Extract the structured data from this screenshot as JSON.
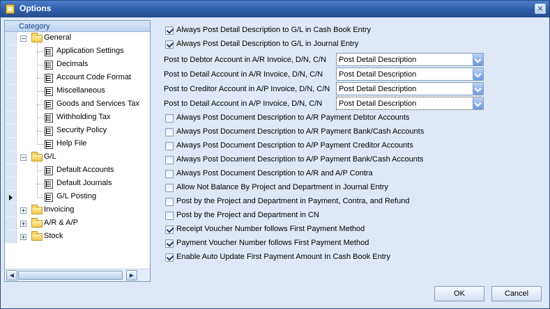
{
  "window": {
    "title": "Options",
    "title_icon": "app-icon",
    "close_icon": "close-icon"
  },
  "tree": {
    "header": "Category",
    "nodes": [
      {
        "label": "General",
        "level": 0,
        "type": "folder",
        "expanded": true
      },
      {
        "label": "Application Settings",
        "level": 1,
        "type": "leaf"
      },
      {
        "label": "Decimals",
        "level": 1,
        "type": "leaf"
      },
      {
        "label": "Account Code Format",
        "level": 1,
        "type": "leaf"
      },
      {
        "label": "Miscellaneous",
        "level": 1,
        "type": "leaf"
      },
      {
        "label": "Goods and Services Tax",
        "level": 1,
        "type": "leaf"
      },
      {
        "label": "Withholding Tax",
        "level": 1,
        "type": "leaf"
      },
      {
        "label": "Security Policy",
        "level": 1,
        "type": "leaf"
      },
      {
        "label": "Help File",
        "level": 1,
        "type": "leaf"
      },
      {
        "label": "G/L",
        "level": 0,
        "type": "folder",
        "expanded": true
      },
      {
        "label": "Default Accounts",
        "level": 1,
        "type": "leaf"
      },
      {
        "label": "Default Journals",
        "level": 1,
        "type": "leaf"
      },
      {
        "label": "G/L Posting",
        "level": 1,
        "type": "leaf",
        "current": true
      },
      {
        "label": "Invoicing",
        "level": 0,
        "type": "folder",
        "expanded": false
      },
      {
        "label": "A/R & A/P",
        "level": 0,
        "type": "folder",
        "expanded": false
      },
      {
        "label": "Stock",
        "level": 0,
        "type": "folder",
        "expanded": false
      }
    ]
  },
  "options": {
    "top_checks": [
      {
        "label": "Always Post Detail Description to G/L in Cash Book Entry",
        "checked": true
      },
      {
        "label": "Always Post Detail Description to G/L in Journal Entry",
        "checked": true
      }
    ],
    "combos": [
      {
        "label": "Post to Debtor Account in A/R Invoice, D/N, C/N",
        "value": "Post Detail Description",
        "focused": false
      },
      {
        "label": "Post to Detail Account in A/R Invoice, D/N, C/N",
        "value": "Post Detail Description",
        "focused": false
      },
      {
        "label": "Post to Creditor Account in A/P Invoice, D/N, C/N",
        "value": "Post Detail Description",
        "focused": false
      },
      {
        "label": "Post to Detail Account in A/P Invoice, D/N, C/N",
        "value": "Post Detail Description",
        "focused": true
      }
    ],
    "bottom_checks": [
      {
        "label": "Always Post Document Description to A/R Payment Debtor Accounts",
        "checked": false
      },
      {
        "label": "Always Post Document Description to A/R Payment Bank/Cash Accounts",
        "checked": false
      },
      {
        "label": "Always Post Document Description to A/P Payment Creditor Accounts",
        "checked": false
      },
      {
        "label": "Always Post Document Description to A/P Payment Bank/Cash Accounts",
        "checked": false
      },
      {
        "label": "Always Post Document Description to A/R and A/P Contra",
        "checked": false
      },
      {
        "label": "Allow Not Balance By Project and Department in Journal Entry",
        "checked": false
      },
      {
        "label": "Post by the Project and Department in Payment, Contra, and Refund",
        "checked": false
      },
      {
        "label": "Post by the Project and Department in CN",
        "checked": false
      },
      {
        "label": "Receipt Voucher Number follows First Payment Method",
        "checked": true
      },
      {
        "label": "Payment Voucher Number follows First Payment Method",
        "checked": true
      },
      {
        "label": "Enable Auto Update First Payment Amount In Cash Book Entry",
        "checked": true
      }
    ]
  },
  "buttons": {
    "ok": "OK",
    "cancel": "Cancel"
  },
  "colors": {
    "title_bar": "#2d5ea8",
    "panel_bg": "#dfe8f6",
    "border": "#7f9db9"
  }
}
